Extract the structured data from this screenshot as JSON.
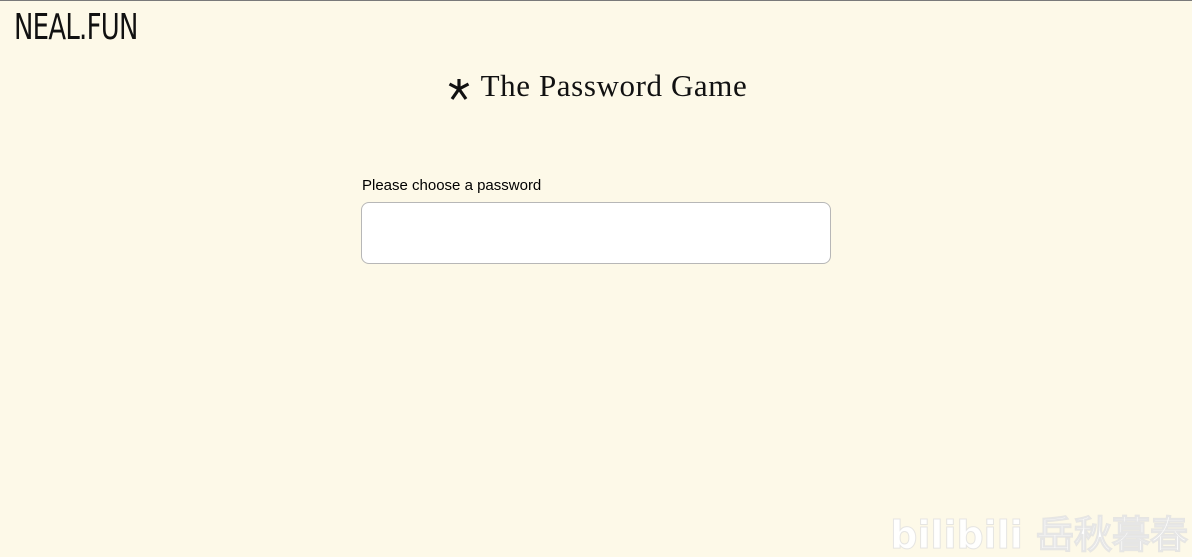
{
  "header": {
    "logo_text": "NEAL.FUN"
  },
  "title": {
    "icon": "asterisk-icon",
    "text": "The Password Game"
  },
  "form": {
    "label": "Please choose a password",
    "password_value": "",
    "placeholder": ""
  },
  "watermark": {
    "text": "bilibili 岳秋暮春"
  },
  "colors": {
    "background": "#fdf9e8",
    "input_background": "#ffffff",
    "input_border": "#b7b7b7",
    "text": "#000000"
  }
}
